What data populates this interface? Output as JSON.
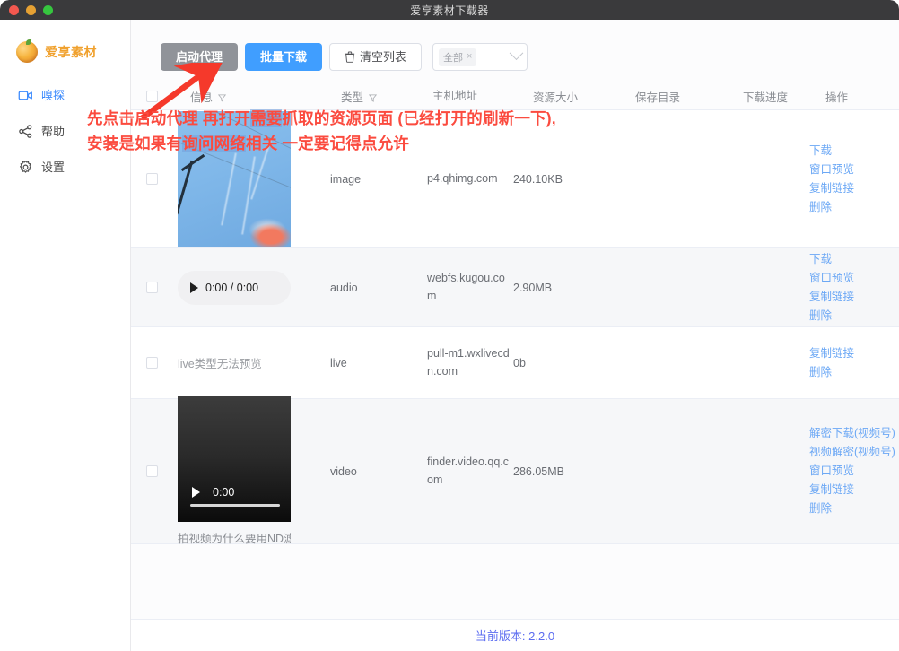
{
  "window": {
    "title": "爱享素材下载器",
    "traffic_lights": [
      "close-red",
      "minimize-yellow",
      "zoom-green"
    ]
  },
  "sidebar": {
    "brand": "爱享素材",
    "items": [
      {
        "label": "嗅探",
        "icon": "video-camera-icon",
        "active": true
      },
      {
        "label": "帮助",
        "icon": "share-icon",
        "active": false
      },
      {
        "label": "设置",
        "icon": "gear-icon",
        "active": false
      }
    ]
  },
  "toolbar": {
    "proxy_label": "启动代理",
    "batch_label": "批量下载",
    "clear_label": "清空列表",
    "clear_icon": "trash-icon",
    "filter": {
      "tag": "全部",
      "tag_close": "×",
      "chevron": "chevron-down-icon"
    }
  },
  "table": {
    "headers": {
      "info": "信息",
      "type": "类型",
      "host": "主机地址",
      "size": "资源大小",
      "dir": "保存目录",
      "progress": "下载进度",
      "actions": "操作"
    },
    "rows": [
      {
        "preview_kind": "image-thumbnail",
        "type": "image",
        "host": "p4.qhimg.com",
        "size": "240.10KB",
        "dir": "",
        "progress": "",
        "actions": [
          "下载",
          "窗口预览",
          "复制链接",
          "删除"
        ]
      },
      {
        "preview_kind": "audio-player",
        "audio_time": "0:00 / 0:00",
        "type": "audio",
        "host": "webfs.kugou.com",
        "size": "2.90MB",
        "dir": "",
        "progress": "",
        "actions": [
          "下载",
          "窗口预览",
          "复制链接",
          "删除"
        ]
      },
      {
        "preview_kind": "text",
        "preview_text": "live类型无法预览",
        "type": "live",
        "host": "pull-m1.wxlivecdn.com",
        "size": "0b",
        "dir": "",
        "progress": "",
        "actions": [
          "复制链接",
          "删除"
        ]
      },
      {
        "preview_kind": "video-player",
        "video_time": "0:00",
        "video_caption": "拍视频为什么要用ND滤",
        "type": "video",
        "host": "finder.video.qq.com",
        "size": "286.05MB",
        "dir": "",
        "progress": "",
        "actions": [
          "解密下载(视频号)",
          "视频解密(视频号)",
          "窗口预览",
          "复制链接",
          "删除"
        ]
      }
    ]
  },
  "footer": {
    "version_text": "当前版本: 2.2.0"
  },
  "annotation": {
    "line1_a": "先点击启动代理 再打开",
    "line1_b": "需要",
    "line1_c": "抓取的资源页面 (已经打开的刷新一下),",
    "line2_a": "安装是如果有",
    "line2_b": "询问网络",
    "line2_c": "相关 一定要记得点允许",
    "arrow": "red-arrow-up-right"
  },
  "colors": {
    "accent_blue": "#409eff",
    "link_blue": "#6ca8f5",
    "brand_orange": "#f0a12e",
    "annotation_red": "#fb4b3f",
    "proxy_gray": "#909399",
    "version_purple": "#5b6cf0"
  }
}
